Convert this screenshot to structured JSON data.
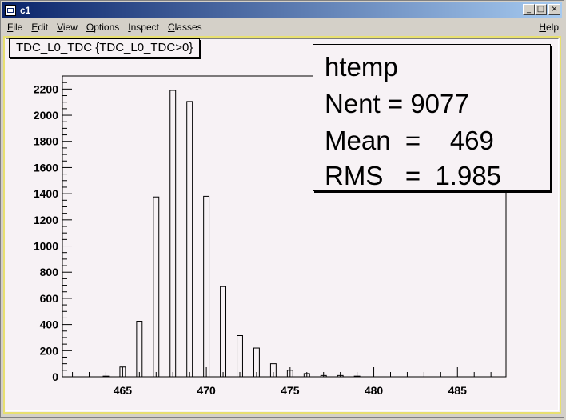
{
  "window": {
    "title": "c1",
    "controls": {
      "minimize": "_",
      "maximize": "□",
      "close": "×"
    }
  },
  "menubar": {
    "items": [
      {
        "label": "File",
        "underline": "F",
        "rest": "ile"
      },
      {
        "label": "Edit",
        "underline": "E",
        "rest": "dit"
      },
      {
        "label": "View",
        "underline": "V",
        "rest": "iew"
      },
      {
        "label": "Options",
        "underline": "O",
        "rest": "ptions"
      },
      {
        "label": "Inspect",
        "underline": "I",
        "rest": "nspect"
      },
      {
        "label": "Classes",
        "underline": "C",
        "rest": "lasses"
      }
    ],
    "help": {
      "label": "Help",
      "underline": "H",
      "rest": "elp"
    }
  },
  "histogram_title": "TDC_L0_TDC {TDC_L0_TDC>0}",
  "stats": {
    "name": "htemp",
    "entries": "Nent = 9077",
    "mean": "Mean  =    469",
    "rms": "RMS   =  1.985"
  },
  "colors": {
    "canvas_bg": "#f7f2f5",
    "frame_border": "#e8e070",
    "titlebar_start": "#0a246a",
    "titlebar_end": "#a6caf0"
  },
  "chart_data": {
    "type": "bar",
    "xlim": [
      461.4,
      487.9
    ],
    "ylim": [
      0,
      2300
    ],
    "x_ticks": [
      465,
      470,
      475,
      480,
      485
    ],
    "y_ticks": [
      0,
      200,
      400,
      600,
      800,
      1000,
      1200,
      1400,
      1600,
      1800,
      2000,
      2200
    ],
    "bin_width": 0.33,
    "bins": [
      {
        "x": 465,
        "y": 75
      },
      {
        "x": 466,
        "y": 425
      },
      {
        "x": 467,
        "y": 1375
      },
      {
        "x": 468,
        "y": 2190
      },
      {
        "x": 469,
        "y": 2105
      },
      {
        "x": 470,
        "y": 1380
      },
      {
        "x": 471,
        "y": 690
      },
      {
        "x": 472,
        "y": 315
      },
      {
        "x": 473,
        "y": 220
      },
      {
        "x": 474,
        "y": 100
      },
      {
        "x": 475,
        "y": 50
      },
      {
        "x": 476,
        "y": 25
      },
      {
        "x": 477,
        "y": 10
      },
      {
        "x": 478,
        "y": 10
      },
      {
        "x": 479,
        "y": 5
      },
      {
        "x": 464,
        "y": 5
      }
    ]
  }
}
